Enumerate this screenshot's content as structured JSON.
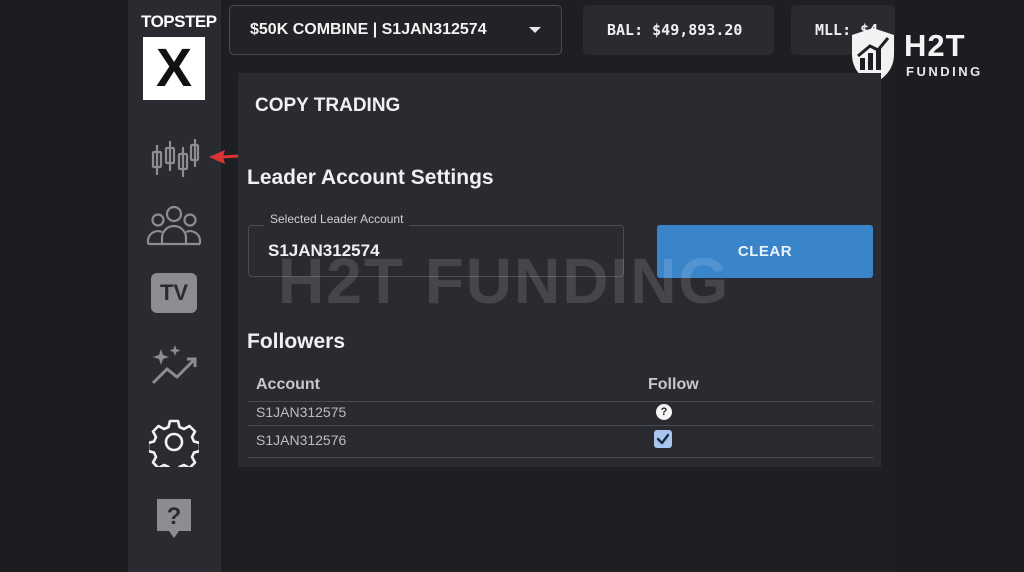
{
  "brand": {
    "name": "TOPSTEP",
    "mark": "X"
  },
  "sidebar": {
    "items": [
      {
        "icon": "candlestick-chart-icon"
      },
      {
        "icon": "users-icon"
      },
      {
        "icon": "tv-icon",
        "label": "TV"
      },
      {
        "icon": "sparkle-trend-icon"
      },
      {
        "icon": "gear-icon"
      },
      {
        "icon": "help-icon",
        "label": "?"
      }
    ]
  },
  "header": {
    "account_selector": "$50K COMBINE | S1JAN312574",
    "balance": "BAL: $49,893.20",
    "mll": "MLL: $4"
  },
  "watermark": {
    "brand": "H2T",
    "sub": "FUNDING",
    "overlay": "H2T FUNDING"
  },
  "copy_trading": {
    "title": "COPY TRADING",
    "leader_section": "Leader Account Settings",
    "leader_field_label": "Selected Leader Account",
    "leader_field_value": "S1JAN312574",
    "clear_label": "CLEAR",
    "followers_title": "Followers",
    "columns": [
      "Account",
      "Follow"
    ],
    "rows": [
      {
        "account": "S1JAN312575",
        "follow": "?"
      },
      {
        "account": "S1JAN312576",
        "follow": "checked"
      }
    ]
  },
  "colors": {
    "accent": "#3a84c9",
    "panel": "#2a2b30",
    "background": "#1e1f23",
    "arrow": "#d93434"
  }
}
